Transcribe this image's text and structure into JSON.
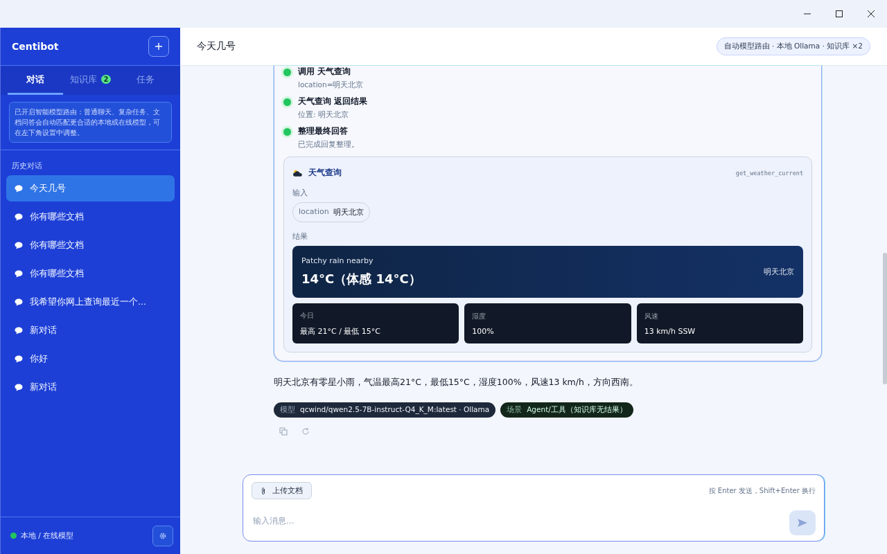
{
  "sidebar": {
    "brand": "Centibot",
    "tabs": [
      {
        "label": "对话",
        "selected": true
      },
      {
        "label": "知识库",
        "badge": "2",
        "selected": false
      },
      {
        "label": "任务",
        "selected": false
      }
    ],
    "notice": "已开启智能模型路由：普通聊天、复杂任务、文档问答会自动匹配更合适的本地或在线模型，可在左下角设置中调整。",
    "history_heading": "历史对话",
    "history": [
      {
        "title": "今天几号",
        "selected": true
      },
      {
        "title": "你有哪些文档",
        "selected": false
      },
      {
        "title": "你有哪些文档",
        "selected": false
      },
      {
        "title": "你有哪些文档",
        "selected": false
      },
      {
        "title": "我希望你网上查询最近一个...",
        "selected": false
      },
      {
        "title": "新对话",
        "selected": false
      },
      {
        "title": "你好",
        "selected": false
      },
      {
        "title": "新对话",
        "selected": false
      }
    ],
    "footer": {
      "status": "本地 / 在线模型",
      "online": true
    }
  },
  "header": {
    "title": "今天几号",
    "route_badge": "自动模型路由 · 本地 Ollama · 知识库 ×2"
  },
  "message": {
    "steps": [
      {
        "title": "调用 天气查询",
        "detail": "location=明天北京",
        "done": true
      },
      {
        "title": "天气查询 返回结果",
        "detail": "位置: 明天北京",
        "done": true
      },
      {
        "title": "整理最终回答",
        "detail": "已完成回复整理。",
        "done": true
      }
    ],
    "tool": {
      "name": "天气查询",
      "function": "get_weather_current",
      "input_label": "输入",
      "inputs": [
        {
          "key": "location",
          "value": "明天北京"
        }
      ],
      "result_label": "结果",
      "weather": {
        "condition": "Patchy rain nearby",
        "temperature": "14°C（体感 14°C）",
        "location": "明天北京"
      },
      "stats": [
        {
          "label": "今日",
          "value": "最高 21°C / 最低 15°C"
        },
        {
          "label": "湿度",
          "value": "100%"
        },
        {
          "label": "风速",
          "value": "13 km/h SSW"
        }
      ]
    },
    "answer": "明天北京有零星小雨，气温最高21°C，最低15°C，湿度100%，风速13 km/h，方向西南。",
    "tags": [
      {
        "kind": "model",
        "label": "模型",
        "value": "qcwind/qwen2.5-7B-instruct-Q4_K_M:latest · Ollama"
      },
      {
        "kind": "scene",
        "label": "场景",
        "value": "Agent/工具（知识库无结果）"
      }
    ]
  },
  "composer": {
    "upload": "上传文档",
    "hint": "按 Enter 发送，Shift+Enter 换行",
    "placeholder": "输入消息..."
  }
}
